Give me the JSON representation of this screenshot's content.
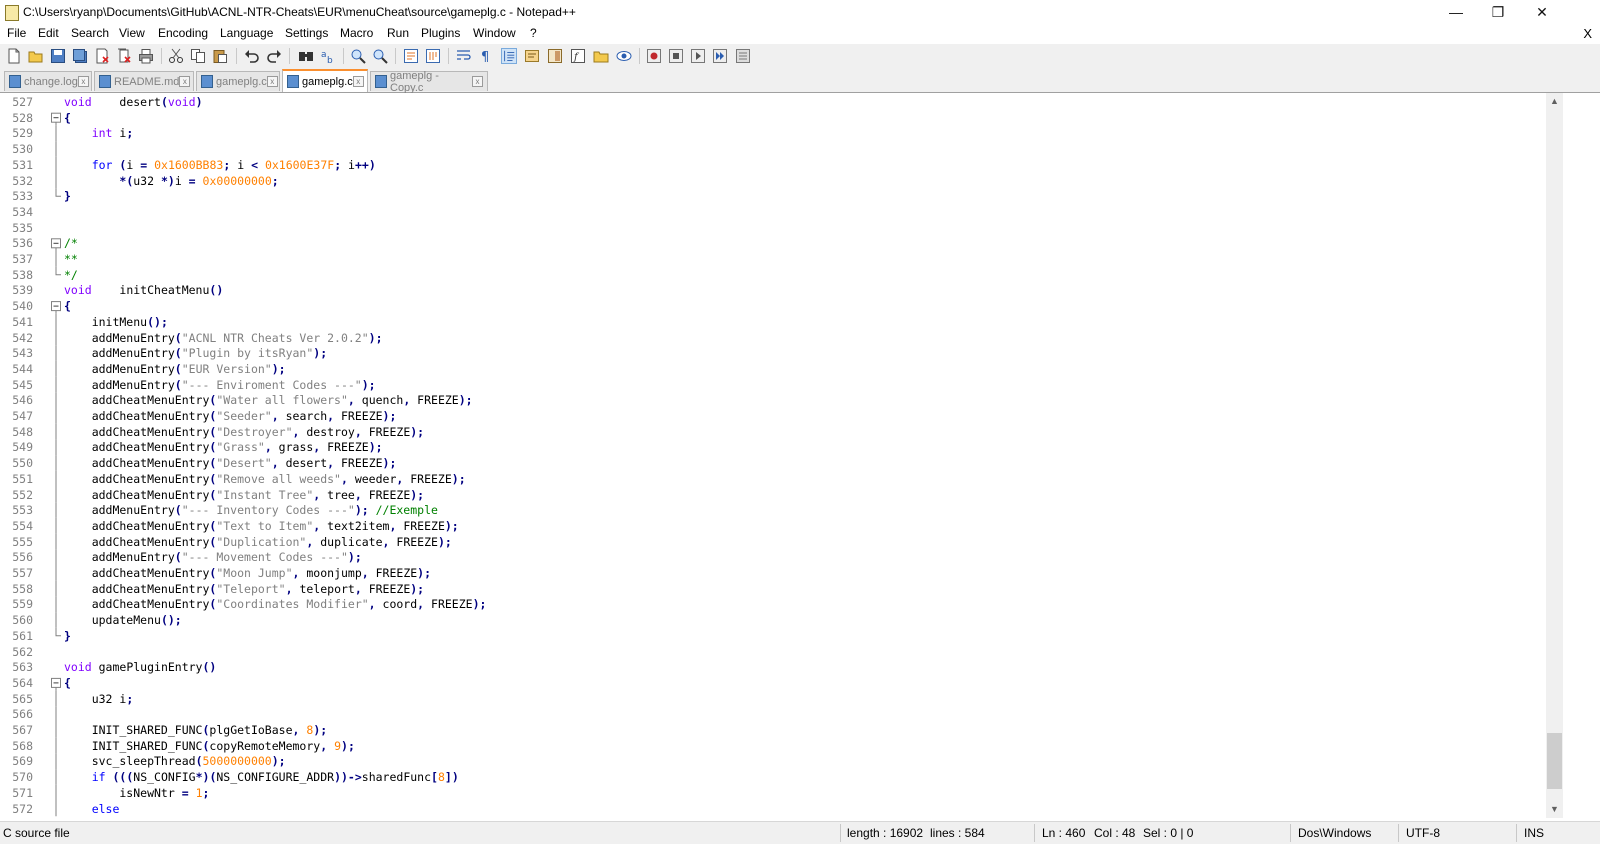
{
  "window": {
    "title": "C:\\Users\\ryanp\\Documents\\GitHub\\ACNL-NTR-Cheats\\EUR\\menuCheat\\source\\gameplg.c - Notepad++",
    "minimize": "—",
    "restore": "❐",
    "close": "✕"
  },
  "menu": {
    "items": [
      "File",
      "Edit",
      "Search",
      "View",
      "Encoding",
      "Language",
      "Settings",
      "Macro",
      "Run",
      "Plugins",
      "Window",
      "?"
    ],
    "close_doc": "X"
  },
  "toolbar": {
    "icons": [
      "new-file-icon",
      "open-file-icon",
      "save-icon",
      "save-all-icon",
      "close-icon",
      "close-all-icon",
      "print-icon",
      "cut-icon",
      "copy-icon",
      "paste-icon",
      "undo-icon",
      "redo-icon",
      "find-icon",
      "replace-icon",
      "zoom-in-icon",
      "zoom-out-icon",
      "sync-v-icon",
      "sync-h-icon",
      "word-wrap-icon",
      "show-all-chars-icon",
      "indent-guide-icon",
      "udl-icon",
      "doc-map-icon",
      "function-list-icon",
      "folder-workspace-icon",
      "monitor-icon",
      "record-macro-icon",
      "stop-macro-icon",
      "play-macro-icon",
      "run-macro-multiple-icon",
      "save-macro-icon"
    ]
  },
  "tabs": [
    {
      "label": "change.log",
      "active": false
    },
    {
      "label": "README.md",
      "active": false
    },
    {
      "label": "gameplg.c",
      "active": false
    },
    {
      "label": "gameplg.c",
      "active": true
    },
    {
      "label": "gameplg - Copy.c",
      "active": false
    }
  ],
  "editor": {
    "lines": [
      {
        "n": "527",
        "fold": "",
        "html": "<span class=\"ty\">void</span>    desert<span class=\"op\">(</span><span class=\"ty\">void</span><span class=\"op\">)</span>"
      },
      {
        "n": "528",
        "fold": "box",
        "html": "<span class=\"op\">{</span>"
      },
      {
        "n": "529",
        "fold": "line",
        "html": "    <span class=\"ty\">int</span> i<span class=\"op\">;</span>"
      },
      {
        "n": "530",
        "fold": "line",
        "html": ""
      },
      {
        "n": "531",
        "fold": "line",
        "html": "    <span class=\"kw\">for</span> <span class=\"op\">(</span>i <span class=\"op\">=</span> <span class=\"num\">0x1600BB83</span><span class=\"op\">;</span> i <span class=\"op\">&lt;</span> <span class=\"num\">0x1600E37F</span><span class=\"op\">;</span> i<span class=\"op\">++)</span>"
      },
      {
        "n": "532",
        "fold": "line",
        "html": "        <span class=\"op\">*(</span>u32 <span class=\"op\">*)</span>i <span class=\"op\">=</span> <span class=\"num\">0x00000000</span><span class=\"op\">;</span>"
      },
      {
        "n": "533",
        "fold": "end",
        "html": "<span class=\"op\">}</span>"
      },
      {
        "n": "534",
        "fold": "",
        "html": ""
      },
      {
        "n": "535",
        "fold": "",
        "html": ""
      },
      {
        "n": "536",
        "fold": "box",
        "html": "<span class=\"cm\">/*</span>"
      },
      {
        "n": "537",
        "fold": "line",
        "html": "<span class=\"cm\">**</span>"
      },
      {
        "n": "538",
        "fold": "end",
        "html": "<span class=\"cm\">*/</span>"
      },
      {
        "n": "539",
        "fold": "",
        "html": "<span class=\"ty\">void</span>    initCheatMenu<span class=\"op\">()</span>"
      },
      {
        "n": "540",
        "fold": "box",
        "html": "<span class=\"op\">{</span>"
      },
      {
        "n": "541",
        "fold": "line",
        "html": "    initMenu<span class=\"op\">();</span>"
      },
      {
        "n": "542",
        "fold": "line",
        "html": "    addMenuEntry<span class=\"op\">(</span><span class=\"str\">\"ACNL NTR Cheats Ver 2.0.2\"</span><span class=\"op\">);</span>"
      },
      {
        "n": "543",
        "fold": "line",
        "html": "    addMenuEntry<span class=\"op\">(</span><span class=\"str\">\"Plugin by itsRyan\"</span><span class=\"op\">);</span>"
      },
      {
        "n": "544",
        "fold": "line",
        "html": "    addMenuEntry<span class=\"op\">(</span><span class=\"str\">\"EUR Version\"</span><span class=\"op\">);</span>"
      },
      {
        "n": "545",
        "fold": "line",
        "html": "    addMenuEntry<span class=\"op\">(</span><span class=\"str\">\"--- Enviroment Codes ---\"</span><span class=\"op\">);</span>"
      },
      {
        "n": "546",
        "fold": "line",
        "html": "    addCheatMenuEntry<span class=\"op\">(</span><span class=\"str\">\"Water all flowers\"</span><span class=\"op\">,</span> quench<span class=\"op\">,</span> FREEZE<span class=\"op\">);</span>"
      },
      {
        "n": "547",
        "fold": "line",
        "html": "    addCheatMenuEntry<span class=\"op\">(</span><span class=\"str\">\"Seeder\"</span><span class=\"op\">,</span> search<span class=\"op\">,</span> FREEZE<span class=\"op\">);</span>"
      },
      {
        "n": "548",
        "fold": "line",
        "html": "    addCheatMenuEntry<span class=\"op\">(</span><span class=\"str\">\"Destroyer\"</span><span class=\"op\">,</span> destroy<span class=\"op\">,</span> FREEZE<span class=\"op\">);</span>"
      },
      {
        "n": "549",
        "fold": "line",
        "html": "    addCheatMenuEntry<span class=\"op\">(</span><span class=\"str\">\"Grass\"</span><span class=\"op\">,</span> grass<span class=\"op\">,</span> FREEZE<span class=\"op\">);</span>"
      },
      {
        "n": "550",
        "fold": "line",
        "html": "    addCheatMenuEntry<span class=\"op\">(</span><span class=\"str\">\"Desert\"</span><span class=\"op\">,</span> desert<span class=\"op\">,</span> FREEZE<span class=\"op\">);</span>"
      },
      {
        "n": "551",
        "fold": "line",
        "html": "    addCheatMenuEntry<span class=\"op\">(</span><span class=\"str\">\"Remove all weeds\"</span><span class=\"op\">,</span> weeder<span class=\"op\">,</span> FREEZE<span class=\"op\">);</span>"
      },
      {
        "n": "552",
        "fold": "line",
        "html": "    addCheatMenuEntry<span class=\"op\">(</span><span class=\"str\">\"Instant Tree\"</span><span class=\"op\">,</span> tree<span class=\"op\">,</span> FREEZE<span class=\"op\">);</span>"
      },
      {
        "n": "553",
        "fold": "line",
        "html": "    addMenuEntry<span class=\"op\">(</span><span class=\"str\">\"--- Inventory Codes ---\"</span><span class=\"op\">);</span> <span class=\"cm\">//Exemple</span>"
      },
      {
        "n": "554",
        "fold": "line",
        "html": "    addCheatMenuEntry<span class=\"op\">(</span><span class=\"str\">\"Text to Item\"</span><span class=\"op\">,</span> text2item<span class=\"op\">,</span> FREEZE<span class=\"op\">);</span>"
      },
      {
        "n": "555",
        "fold": "line",
        "html": "    addCheatMenuEntry<span class=\"op\">(</span><span class=\"str\">\"Duplication\"</span><span class=\"op\">,</span> duplicate<span class=\"op\">,</span> FREEZE<span class=\"op\">);</span>"
      },
      {
        "n": "556",
        "fold": "line",
        "html": "    addMenuEntry<span class=\"op\">(</span><span class=\"str\">\"--- Movement Codes ---\"</span><span class=\"op\">);</span>"
      },
      {
        "n": "557",
        "fold": "line",
        "html": "    addCheatMenuEntry<span class=\"op\">(</span><span class=\"str\">\"Moon Jump\"</span><span class=\"op\">,</span> moonjump<span class=\"op\">,</span> FREEZE<span class=\"op\">);</span>"
      },
      {
        "n": "558",
        "fold": "line",
        "html": "    addCheatMenuEntry<span class=\"op\">(</span><span class=\"str\">\"Teleport\"</span><span class=\"op\">,</span> teleport<span class=\"op\">,</span> FREEZE<span class=\"op\">);</span>"
      },
      {
        "n": "559",
        "fold": "line",
        "html": "    addCheatMenuEntry<span class=\"op\">(</span><span class=\"str\">\"Coordinates Modifier\"</span><span class=\"op\">,</span> coord<span class=\"op\">,</span> FREEZE<span class=\"op\">);</span>"
      },
      {
        "n": "560",
        "fold": "line",
        "html": "    updateMenu<span class=\"op\">();</span>"
      },
      {
        "n": "561",
        "fold": "end",
        "html": "<span class=\"op\">}</span>"
      },
      {
        "n": "562",
        "fold": "",
        "html": ""
      },
      {
        "n": "563",
        "fold": "",
        "html": "<span class=\"ty\">void</span> gamePluginEntry<span class=\"op\">()</span>"
      },
      {
        "n": "564",
        "fold": "box",
        "html": "<span class=\"op\">{</span>"
      },
      {
        "n": "565",
        "fold": "line",
        "html": "    u32 i<span class=\"op\">;</span>"
      },
      {
        "n": "566",
        "fold": "line",
        "html": ""
      },
      {
        "n": "567",
        "fold": "line",
        "html": "    INIT_SHARED_FUNC<span class=\"op\">(</span>plgGetIoBase<span class=\"op\">,</span> <span class=\"num\">8</span><span class=\"op\">);</span>"
      },
      {
        "n": "568",
        "fold": "line",
        "html": "    INIT_SHARED_FUNC<span class=\"op\">(</span>copyRemoteMemory<span class=\"op\">,</span> <span class=\"num\">9</span><span class=\"op\">);</span>"
      },
      {
        "n": "569",
        "fold": "line",
        "html": "    svc_sleepThread<span class=\"op\">(</span><span class=\"num\">5000000000</span><span class=\"op\">);</span>"
      },
      {
        "n": "570",
        "fold": "line",
        "html": "    <span class=\"kw\">if</span> <span class=\"op\">(((</span>NS_CONFIG<span class=\"op\">*)(</span>NS_CONFIGURE_ADDR<span class=\"op\">))-&gt;</span>sharedFunc<span class=\"op\">[</span><span class=\"num\">8</span><span class=\"op\">])</span>"
      },
      {
        "n": "571",
        "fold": "line",
        "html": "        isNewNtr <span class=\"op\">=</span> <span class=\"num\">1</span><span class=\"op\">;</span>"
      },
      {
        "n": "572",
        "fold": "line",
        "html": "    <span class=\"kw\">else</span>"
      }
    ]
  },
  "status": {
    "file_type": "C source file",
    "length": "length : 16902",
    "lines": "lines : 584",
    "ln": "Ln : 460",
    "col": "Col : 48",
    "sel": "Sel : 0 | 0",
    "eol": "Dos\\Windows",
    "encoding": "UTF-8",
    "mode": "INS"
  }
}
